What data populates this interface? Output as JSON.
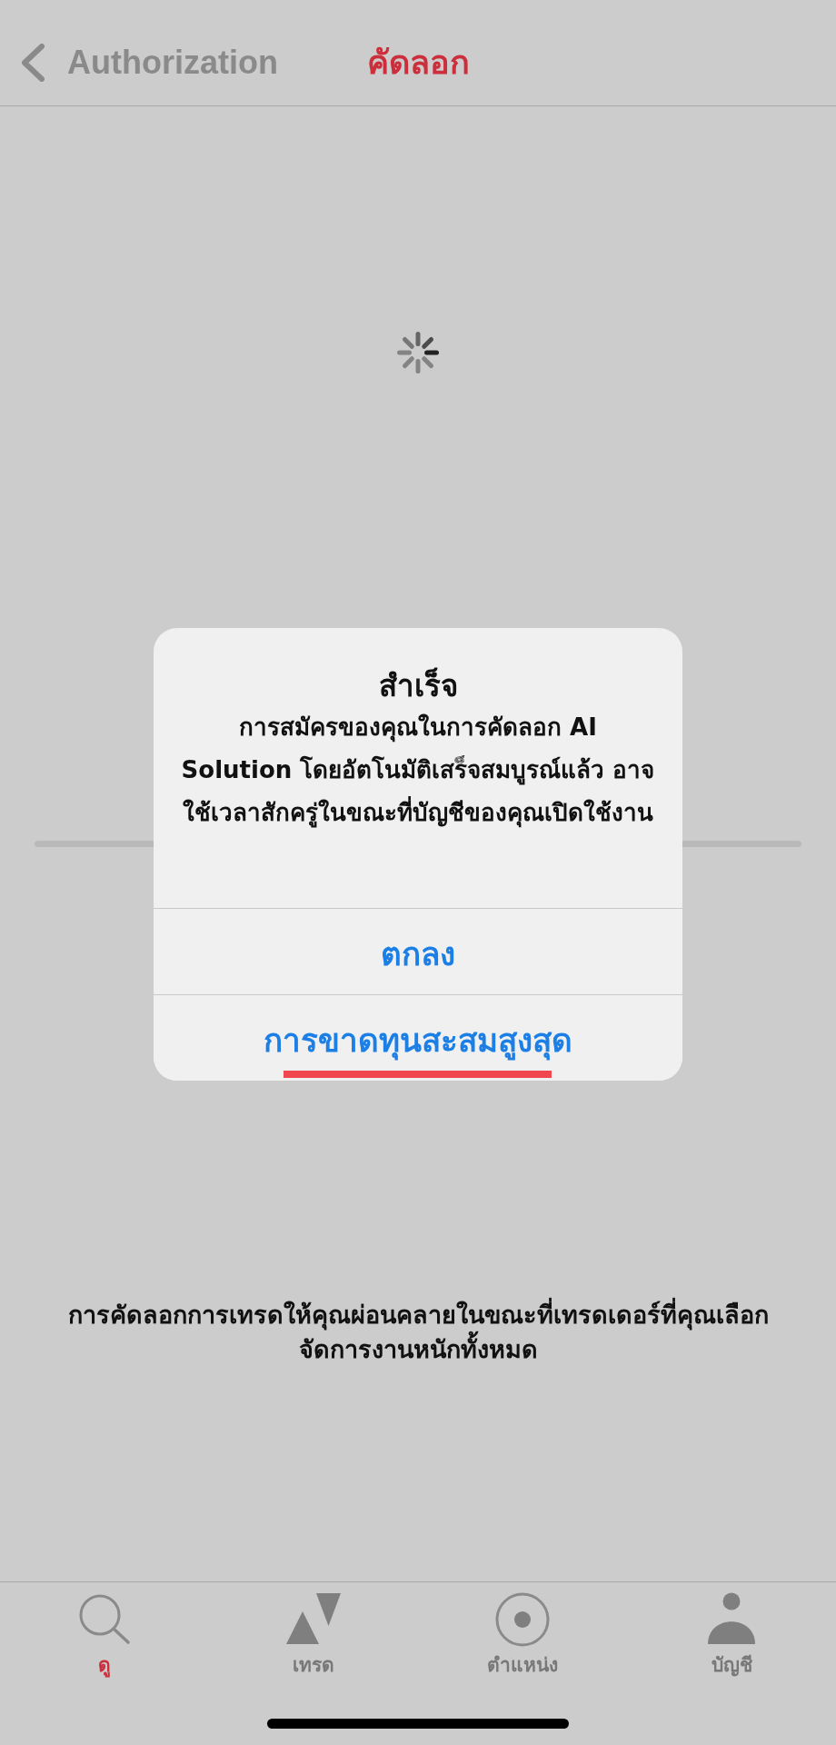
{
  "header": {
    "back_label": "Authorization",
    "title": "คัดลอก"
  },
  "loading": true,
  "dialog": {
    "title": "สำเร็จ",
    "message": "การสมัครของคุณในการคัดลอก AI Solution โดยอัตโนมัติเสร็จสมบูรณ์แล้ว อาจใช้เวลาสักครู่ในขณะที่บัญชีของคุณเปิดใช้งาน",
    "buttons": [
      {
        "label": "ตกลง",
        "highlighted": false
      },
      {
        "label": "การขาดทุนสะสมสูงสุด",
        "highlighted": true
      }
    ]
  },
  "description": "การคัดลอกการเทรดให้คุณผ่อนคลายในขณะที่เทรดเดอร์ที่คุณเลือกจัดการงานหนักทั้งหมด",
  "tabs": [
    {
      "label": "ดู",
      "selected": true
    },
    {
      "label": "เทรด",
      "selected": false
    },
    {
      "label": "ตำแหน่ง",
      "selected": false
    },
    {
      "label": "บัญชี",
      "selected": false
    }
  ]
}
